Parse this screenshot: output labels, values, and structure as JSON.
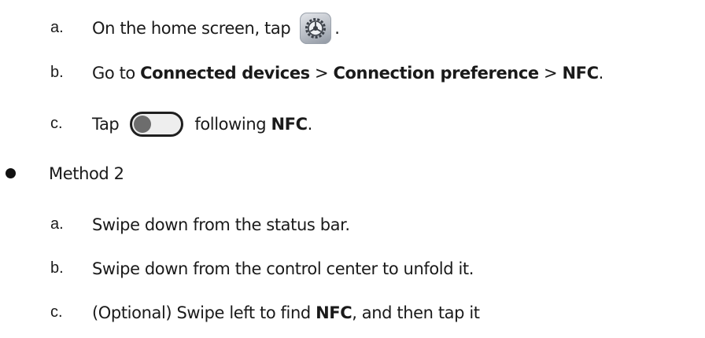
{
  "method1_steps": [
    {
      "marker": "a.",
      "text_before": "On the home screen, tap",
      "icon": "settings-gear-icon",
      "text_after": "."
    },
    {
      "marker": "b.",
      "prefix": "Go to ",
      "item1": "Connected devices",
      "sep1": " > ",
      "item2": "Connection preference",
      "sep2": " > ",
      "item3": "NFC",
      "suffix": "."
    },
    {
      "marker": "c.",
      "text_before": "Tap",
      "icon": "toggle-switch-off-icon",
      "text_middle": "following ",
      "bold": "NFC",
      "text_after": "."
    }
  ],
  "method2": {
    "label": "Method 2",
    "steps": [
      {
        "marker": "a.",
        "text": "Swipe down from the status bar."
      },
      {
        "marker": "b.",
        "text": "Swipe down from the control center to unfold it."
      },
      {
        "marker": "c.",
        "text_before": "(Optional) Swipe left to find ",
        "bold": "NFC",
        "text_after": ", and then tap it"
      }
    ]
  }
}
